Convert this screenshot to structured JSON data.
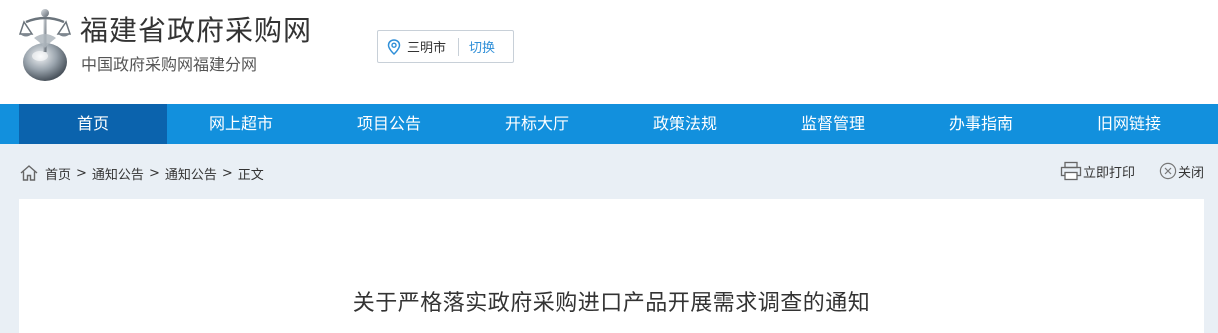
{
  "header": {
    "site_title": "福建省政府采购网",
    "site_subtitle": "中国政府采购网福建分网",
    "logo_icon": "scales-of-justice-emblem-icon"
  },
  "city_selector": {
    "city": "三明市",
    "switch_label": "切换",
    "icon": "location-pin-icon"
  },
  "nav": {
    "items": [
      {
        "label": "首页",
        "active": true
      },
      {
        "label": "网上超市"
      },
      {
        "label": "项目公告"
      },
      {
        "label": "开标大厅"
      },
      {
        "label": "政策法规"
      },
      {
        "label": "监督管理"
      },
      {
        "label": "办事指南"
      },
      {
        "label": "旧网链接"
      }
    ]
  },
  "breadcrumb": {
    "items": [
      "首页",
      "通知公告",
      "通知公告",
      "正文"
    ],
    "separator": ">"
  },
  "tools": {
    "print_label": "立即打印",
    "close_label": "关闭"
  },
  "article": {
    "title": "关于严格落实政府采购进口产品开展需求调查的通知"
  },
  "colors": {
    "nav_bg": "#1290dd",
    "nav_active": "#0b63ad",
    "content_bg": "#e9eff5",
    "link_blue": "#2f8fd8"
  }
}
